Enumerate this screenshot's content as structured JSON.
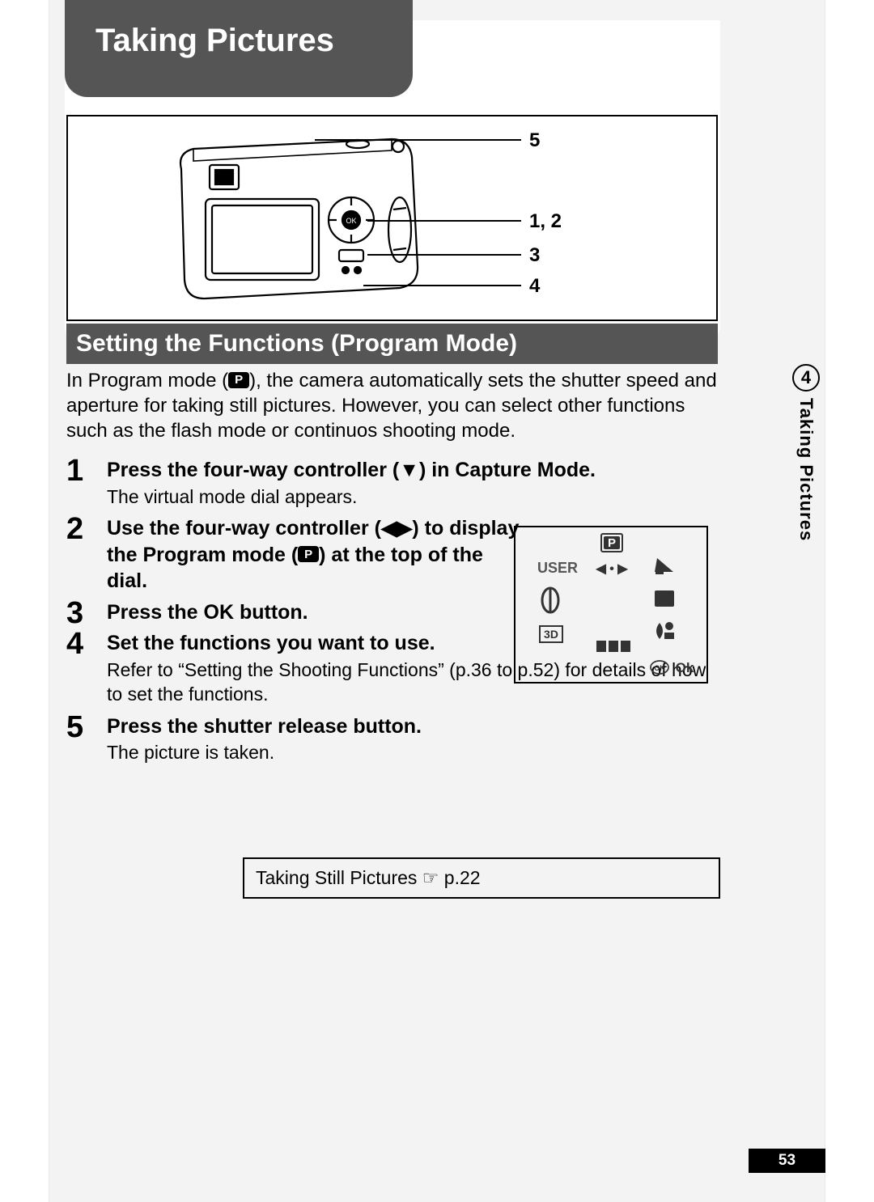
{
  "chapter": {
    "title": "Taking Pictures",
    "number": "4"
  },
  "diagram": {
    "callouts": {
      "a": "5",
      "b": "1, 2",
      "c": "3",
      "d": "4"
    }
  },
  "section": {
    "heading": "Setting the Functions (Program Mode)"
  },
  "intro": {
    "pre": "In Program mode (",
    "icon": "P",
    "post": "), the camera automatically sets the shutter speed and aperture for taking still pictures. However, you can select other functions such as the flash mode or continuos shooting mode."
  },
  "steps": [
    {
      "n": "1",
      "head": "Press the four-way controller (▼) in Capture Mode.",
      "detail": "The virtual mode dial appears."
    },
    {
      "n": "2",
      "head_pre": "Use the four-way controller (◀▶) to display the Program mode (",
      "head_icon": "P",
      "head_post": ") at the top of the dial."
    },
    {
      "n": "3",
      "head": "Press the OK button."
    },
    {
      "n": "4",
      "head": "Set the functions you want to use.",
      "detail": "Refer to “Setting the Shooting Functions” (p.36 to p.52) for details of how to set the functions."
    },
    {
      "n": "5",
      "head": "Press the shutter release button.",
      "detail": "The picture is taken."
    }
  ],
  "mode_dial": {
    "top_icon": "P",
    "left": "USER",
    "arrows": "◀ • ▶",
    "threeD": "3D",
    "ok": "Ok",
    "ok_badge": "OK"
  },
  "reference": {
    "text": "Taking Still Pictures ☞ p.22"
  },
  "side": {
    "num": "4",
    "label": "Taking Pictures"
  },
  "page": {
    "num": "53"
  }
}
